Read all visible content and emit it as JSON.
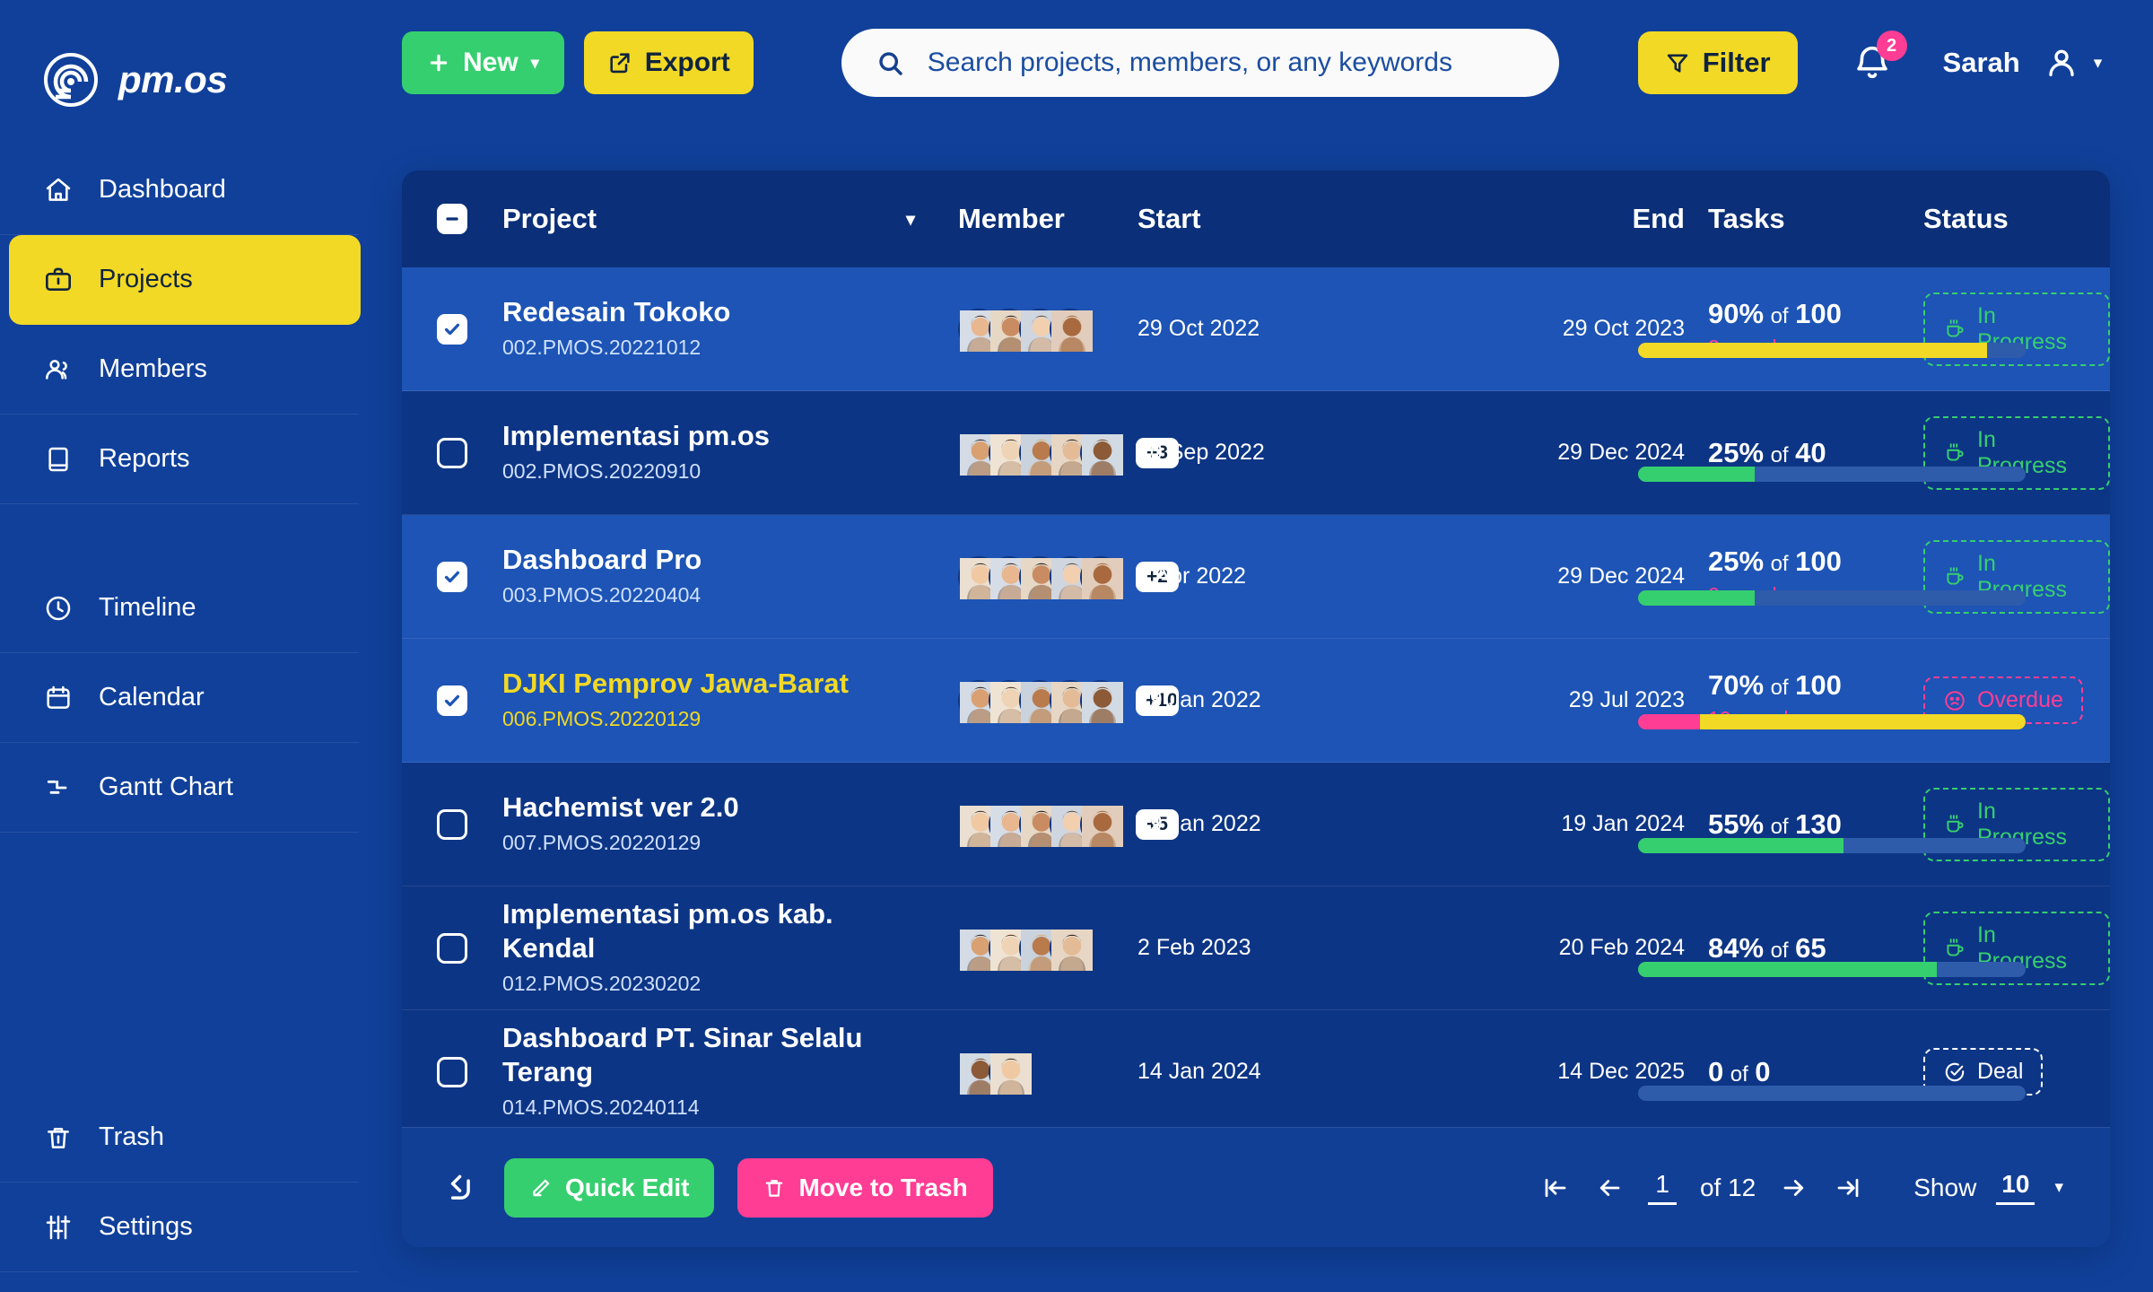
{
  "brand": {
    "name": "pm.os",
    "logo_icon": "spiral-logo-icon"
  },
  "sidebar": {
    "items": [
      {
        "label": "Dashboard",
        "icon": "home-icon",
        "active": false
      },
      {
        "label": "Projects",
        "icon": "briefcase-icon",
        "active": true
      },
      {
        "label": "Members",
        "icon": "users-icon",
        "active": false
      },
      {
        "label": "Reports",
        "icon": "book-icon",
        "active": false
      },
      {
        "label": "Timeline",
        "icon": "clock-icon",
        "active": false
      },
      {
        "label": "Calendar",
        "icon": "calendar-icon",
        "active": false
      },
      {
        "label": "Gantt Chart",
        "icon": "gantt-icon",
        "active": false
      },
      {
        "label": "Trash",
        "icon": "trash-icon",
        "active": false
      },
      {
        "label": "Settings",
        "icon": "sliders-icon",
        "active": false
      }
    ]
  },
  "topbar": {
    "new_label": "New",
    "new_icon": "plus-icon",
    "new_caret": "▾",
    "export_label": "Export",
    "export_icon": "external-link-icon",
    "search_placeholder": "Search projects, members, or any keywords",
    "search_value": "",
    "search_icon": "search-icon",
    "filter_label": "Filter",
    "filter_icon": "funnel-icon",
    "notification_icon": "bell-icon",
    "notification_count": "2",
    "user_name": "Sarah",
    "user_icon": "person-icon",
    "user_caret": "▾"
  },
  "table": {
    "select_all_state": "indeterminate",
    "columns": {
      "project": "Project",
      "sort_caret": "▾",
      "member": "Member",
      "start": "Start",
      "end": "End",
      "tasks": "Tasks",
      "status": "Status"
    },
    "tasks_of_label": "of",
    "rows": [
      {
        "selected": true,
        "highlight": false,
        "name": "Redesain Tokoko",
        "code": "002.PMOS.20221012",
        "avatars": 4,
        "more": "",
        "start": "29 Oct 2022",
        "end": "29 Oct 2023",
        "percent": "90%",
        "total": "100",
        "overdue": "3 overdue",
        "progress": [
          {
            "color": "#f2d925",
            "pct": 90
          }
        ],
        "status": "In Progress",
        "status_type": "inprogress",
        "status_icon": "coffee-icon"
      },
      {
        "selected": false,
        "highlight": false,
        "name": "Implementasi pm.os",
        "code": "002.PMOS.20220910",
        "avatars": 5,
        "more": "+3",
        "start": "10 Sep 2022",
        "end": "29 Dec 2024",
        "percent": "25%",
        "total": "40",
        "overdue": "",
        "progress": [
          {
            "color": "#36cf6f",
            "pct": 30
          }
        ],
        "status": "In Progress",
        "status_type": "inprogress",
        "status_icon": "coffee-icon"
      },
      {
        "selected": true,
        "highlight": false,
        "name": "Dashboard Pro",
        "code": "003.PMOS.20220404",
        "avatars": 5,
        "more": "+2",
        "start": "4 Apr 2022",
        "end": "29 Dec 2024",
        "percent": "25%",
        "total": "100",
        "overdue": "2 overdue",
        "progress": [
          {
            "color": "#36cf6f",
            "pct": 30
          }
        ],
        "status": "In Progress",
        "status_type": "inprogress",
        "status_icon": "coffee-icon"
      },
      {
        "selected": true,
        "highlight": true,
        "name": "DJKI Pemprov Jawa-Barat",
        "code": "006.PMOS.20220129",
        "avatars": 5,
        "more": "+10",
        "start": "29 Jan 2022",
        "end": "29 Jul 2023",
        "percent": "70%",
        "total": "100",
        "overdue": "10 overdue",
        "progress": [
          {
            "color": "#ff3d94",
            "pct": 16
          },
          {
            "color": "#f2d925",
            "pct": 84
          }
        ],
        "status": "Overdue",
        "status_type": "overdue-b",
        "status_icon": "sad-face-icon"
      },
      {
        "selected": false,
        "highlight": false,
        "name": "Hachemist ver 2.0",
        "code": "007.PMOS.20220129",
        "avatars": 5,
        "more": "+5",
        "start": "29 Jan 2022",
        "end": "19 Jan 2024",
        "percent": "55%",
        "total": "130",
        "overdue": "",
        "progress": [
          {
            "color": "#36cf6f",
            "pct": 53
          }
        ],
        "status": "In Progress",
        "status_type": "inprogress",
        "status_icon": "coffee-icon"
      },
      {
        "selected": false,
        "highlight": false,
        "name": "Implementasi pm.os kab. Kendal",
        "code": "012.PMOS.20230202",
        "avatars": 4,
        "more": "",
        "start": "2 Feb 2023",
        "end": "20 Feb 2024",
        "percent": "84%",
        "total": "65",
        "overdue": "",
        "progress": [
          {
            "color": "#36cf6f",
            "pct": 77
          }
        ],
        "status": "In Progress",
        "status_type": "inprogress",
        "status_icon": "coffee-icon"
      },
      {
        "selected": false,
        "highlight": false,
        "name": "Dashboard PT. Sinar Selalu Terang",
        "code": "014.PMOS.20240114",
        "avatars": 2,
        "more": "",
        "start": "14 Jan 2024",
        "end": "14 Dec 2025",
        "percent": "0",
        "total": "0",
        "overdue": "",
        "progress": [],
        "status": "Deal",
        "status_type": "deal",
        "status_icon": "check-circle-icon"
      }
    ]
  },
  "footer": {
    "undo_icon": "undo-arrow-icon",
    "quick_edit_label": "Quick Edit",
    "quick_edit_icon": "pencil-icon",
    "move_to_trash_label": "Move to Trash",
    "move_to_trash_icon": "trash-icon",
    "first_icon": "first-page-icon",
    "prev_icon": "prev-page-icon",
    "current_page": "1",
    "of_pages": "of 12",
    "next_icon": "next-page-icon",
    "last_icon": "last-page-icon",
    "show_label": "Show",
    "show_value": "10",
    "show_caret": "▾"
  },
  "colors": {
    "bg": "#10409a",
    "panel": "#123f96",
    "row": "#0d3585",
    "row_selected": "#1d54b5",
    "header": "#0b2f78",
    "accent_yellow": "#f2d925",
    "accent_green": "#36cf6f",
    "accent_pink": "#ff3d94",
    "text": "#ffffff"
  }
}
